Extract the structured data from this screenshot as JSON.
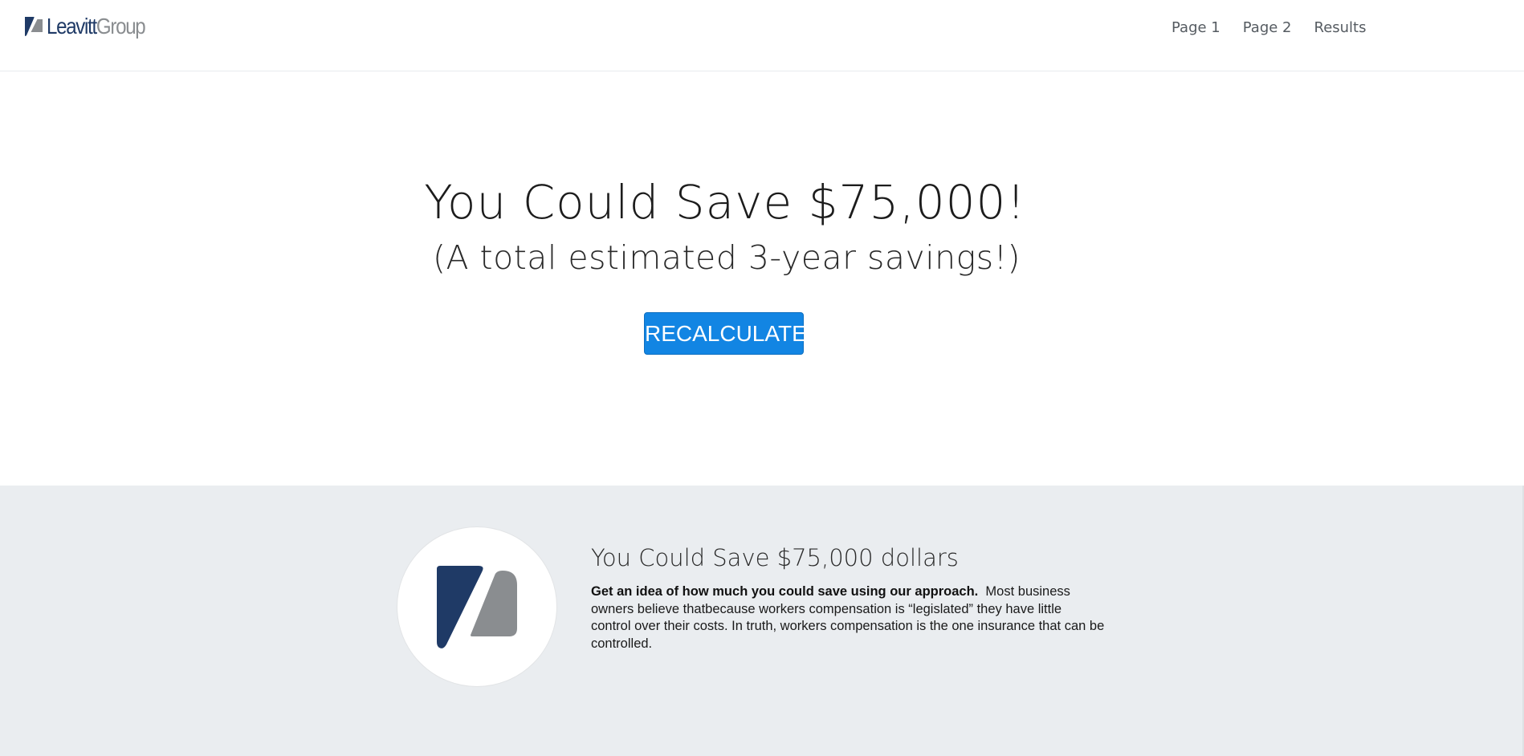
{
  "header": {
    "brand": {
      "name_part1": "Leavitt",
      "name_part2": "Group",
      "logo_icon": "leavitt-logo-icon",
      "colors": {
        "navy": "#1f3a66",
        "gray": "#8a8d90"
      }
    },
    "nav": [
      {
        "label": "Page 1"
      },
      {
        "label": "Page 2"
      },
      {
        "label": "Results"
      }
    ]
  },
  "hero": {
    "title": "You Could Save $75,000!",
    "subtitle": "(A total estimated 3-year savings!)",
    "button_label": "RECALCULATE",
    "button_color": "#1285e3"
  },
  "info": {
    "logo_icon": "leavitt-logo-icon",
    "title": "You Could Save $75,000 dollars",
    "body_bold": "Get an idea of how much you could save using our approach.",
    "body_text": "Most business owners believe thatbecause workers compensation is “legislated” they have little control over their costs. In truth, workers compensation is the one insurance that can be controlled.",
    "background": "#eaedf0"
  }
}
